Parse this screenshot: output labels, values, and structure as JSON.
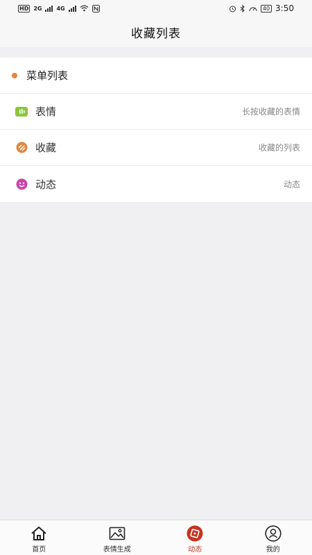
{
  "status_bar": {
    "hd": "HD",
    "net1": "2G",
    "net2": "4G",
    "battery": "40",
    "time": "3:50"
  },
  "header": {
    "title": "收藏列表"
  },
  "menu": {
    "section_title": "菜单列表",
    "items": [
      {
        "label": "表情",
        "desc": "长按收藏的表情",
        "icon": "emoji-chat-icon",
        "color": "#8cc63f"
      },
      {
        "label": "收藏",
        "desc": "收藏的列表",
        "icon": "favorite-icon",
        "color": "#e0873e"
      },
      {
        "label": "动态",
        "desc": "动态",
        "icon": "smiley-icon",
        "color": "#c944a8"
      }
    ]
  },
  "tabs": [
    {
      "label": "首页",
      "icon": "home-icon",
      "active": false
    },
    {
      "label": "表情生成",
      "icon": "image-icon",
      "active": false
    },
    {
      "label": "动态",
      "icon": "compass-icon",
      "active": true
    },
    {
      "label": "我的",
      "icon": "profile-icon",
      "active": false
    }
  ],
  "colors": {
    "accent": "#c8331f",
    "background": "#f0eff2",
    "dot": "#e0873e"
  }
}
